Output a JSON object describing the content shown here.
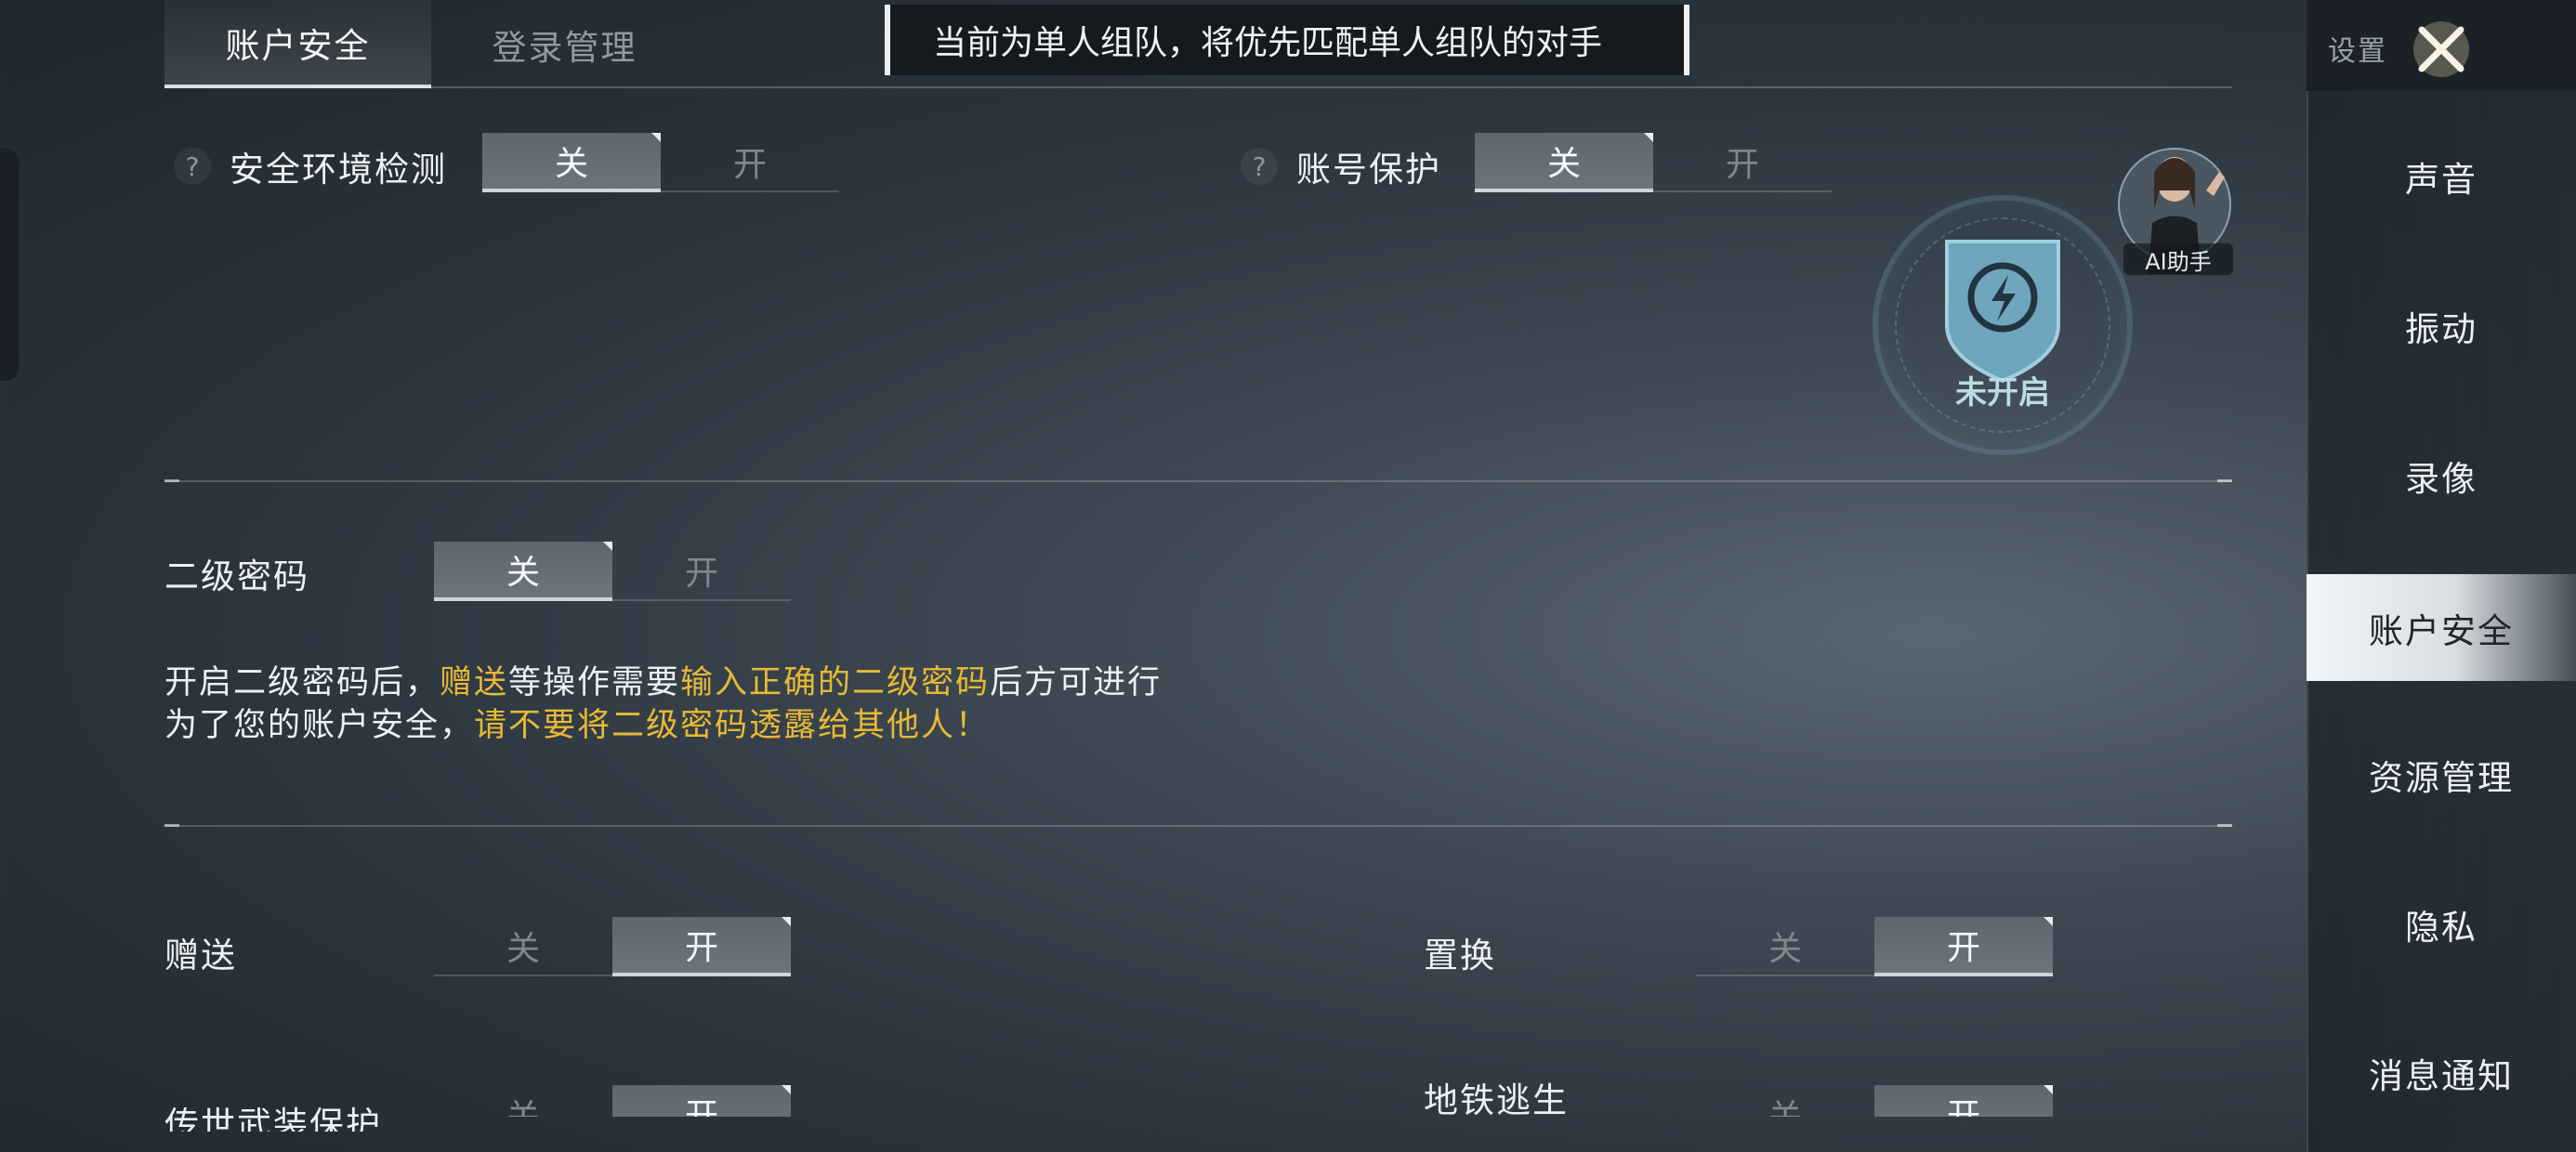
{
  "top_tabs": [
    {
      "label": "账户安全",
      "active": true
    },
    {
      "label": "登录管理",
      "active": false
    }
  ],
  "toast": "当前为单人组队，将优先匹配单人组队的对手",
  "settings": {
    "security_env": {
      "help": "?",
      "label": "安全环境检测",
      "off": "关",
      "on": "开",
      "value": "关"
    },
    "account_protect": {
      "help": "?",
      "label": "账号保护",
      "off": "关",
      "on": "开",
      "value": "关"
    },
    "second_password": {
      "label": "二级密码",
      "off": "关",
      "on": "开",
      "value": "关"
    },
    "gift": {
      "label": "赠送",
      "off": "关",
      "on": "开",
      "value": "开"
    },
    "replace": {
      "label": "置换",
      "off": "关",
      "on": "开",
      "value": "开"
    },
    "legend_weapon": {
      "label": "传世武装保护",
      "off": "关",
      "on": "开",
      "value": "开"
    },
    "metro": {
      "label": "地铁逃生",
      "off": "关",
      "on": "开",
      "value": "开"
    }
  },
  "notice": {
    "line1": [
      {
        "text": "开启二级密码后，",
        "highlight": false
      },
      {
        "text": "赠送",
        "highlight": true
      },
      {
        "text": "等操作需要",
        "highlight": false
      },
      {
        "text": "输入正确的二级密码",
        "highlight": true
      },
      {
        "text": "后方可进行",
        "highlight": false
      }
    ],
    "line2": [
      {
        "text": "为了您的账户安全，",
        "highlight": false
      },
      {
        "text": "请不要将二级密码透露给其他人！",
        "highlight": true
      }
    ]
  },
  "shield_status": "未开启",
  "ai_assistant": "AI助手",
  "sidebar": {
    "title": "设置",
    "items": [
      {
        "label": "声音",
        "active": false
      },
      {
        "label": "振动",
        "active": false
      },
      {
        "label": "录像",
        "active": false
      },
      {
        "label": "账户安全",
        "active": true
      },
      {
        "label": "资源管理",
        "active": false
      },
      {
        "label": "隐私",
        "active": false
      },
      {
        "label": "消息通知",
        "active": false
      }
    ]
  },
  "colors": {
    "highlight": "#e8b934",
    "accent_shield": "#6fa6bd"
  }
}
